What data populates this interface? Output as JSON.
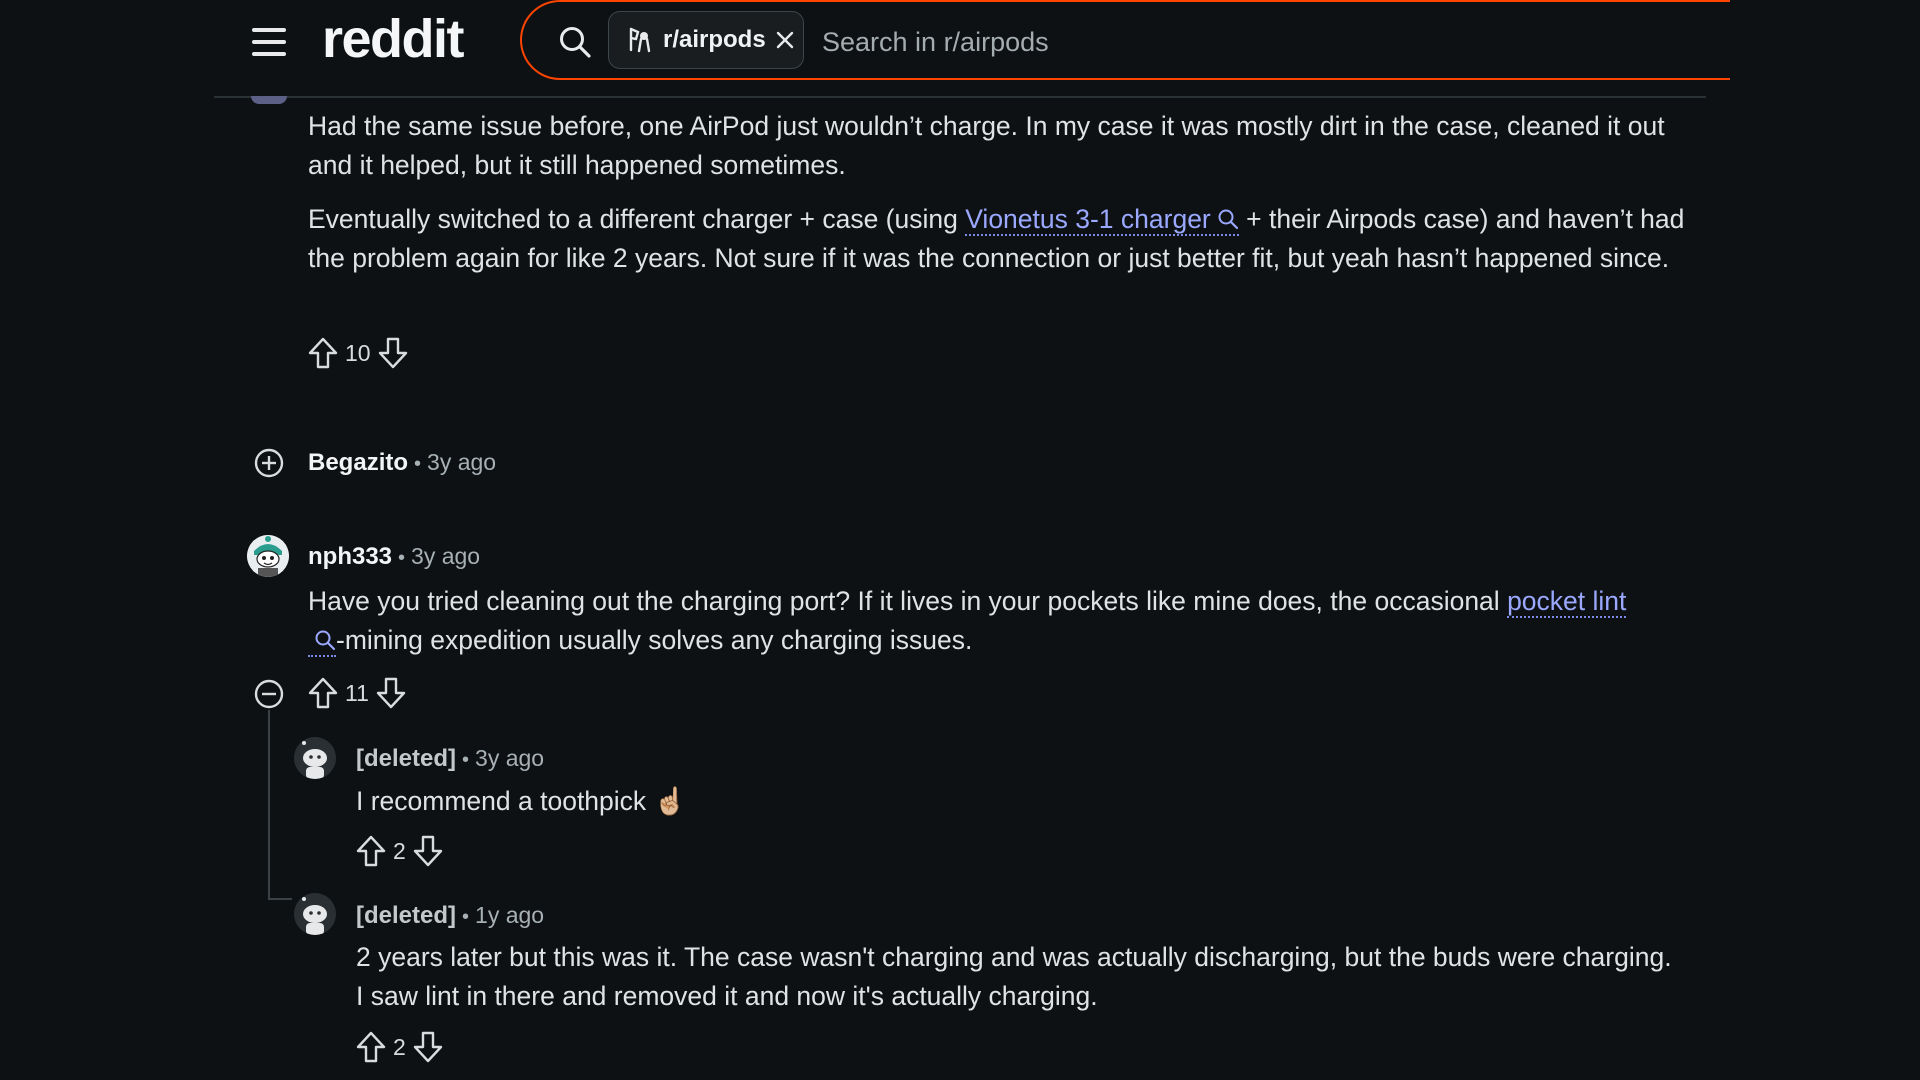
{
  "header": {
    "logo_text": "reddit",
    "subreddit_chip": "r/airpods",
    "search_placeholder": "Search in r/airpods"
  },
  "colors": {
    "accent": "#ff4500",
    "background": "#0e1113",
    "link": "#9aa8ff"
  },
  "comments": [
    {
      "paragraphs": [
        "Had the same issue before, one AirPod just wouldn’t charge. In my case it was mostly dirt in the case, cleaned it out and it helped, but it still happened sometimes."
      ],
      "p2_before": "Eventually switched to a different charger + case (using ",
      "p2_link": "Vionetus 3-1 charger",
      "p2_after": " + their Airpods case) and haven’t had the problem again for like 2 years. Not sure if it was the connection or just better fit, but yeah hasn’t happened since.",
      "votes": "10"
    },
    {
      "author": "Begazito",
      "time": "3y ago",
      "collapsed": true
    },
    {
      "author": "nph333",
      "time": "3y ago",
      "body_before": "Have you tried cleaning out the charging port? If it lives in your pockets like mine does, the occasional ",
      "body_link": "pocket lint",
      "body_after": "-mining expedition usually solves any charging issues.",
      "votes": "11",
      "replies": [
        {
          "author": "[deleted]",
          "time": "3y ago",
          "body": "I recommend a toothpick ☝🏼",
          "votes": "2"
        },
        {
          "author": "[deleted]",
          "time": "1y ago",
          "body": "2 years later but this was it. The case wasn't charging and was actually discharging, but the buds were charging. I saw lint in there and removed it and now it's actually charging.",
          "votes": "2"
        }
      ]
    }
  ]
}
